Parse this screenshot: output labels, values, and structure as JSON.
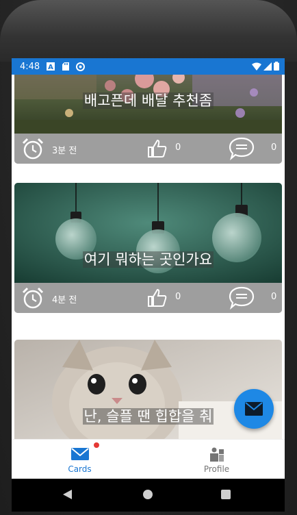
{
  "status_bar": {
    "time": "4:48",
    "background": "#1976d2"
  },
  "cards": [
    {
      "title": "배고픈데 배달 추천좀",
      "time": "3분 전",
      "likes": "0",
      "comments": "0",
      "image": "flowers-photo"
    },
    {
      "title": "여기 뭐하는 곳인가요",
      "time": "4분 전",
      "likes": "0",
      "comments": "0",
      "image": "light-bulbs-photo"
    },
    {
      "title": "난, 슬플 땐 힙합을 춰",
      "image": "kitten-photo"
    }
  ],
  "fab": {
    "icon": "mail-icon",
    "color": "#1e88e5"
  },
  "bottom_nav": {
    "items": [
      {
        "label": "Cards",
        "icon": "mail-icon",
        "active": true,
        "color": "#1976d2"
      },
      {
        "label": "Profile",
        "icon": "profile-icon",
        "active": false,
        "color": "#757575"
      }
    ]
  }
}
